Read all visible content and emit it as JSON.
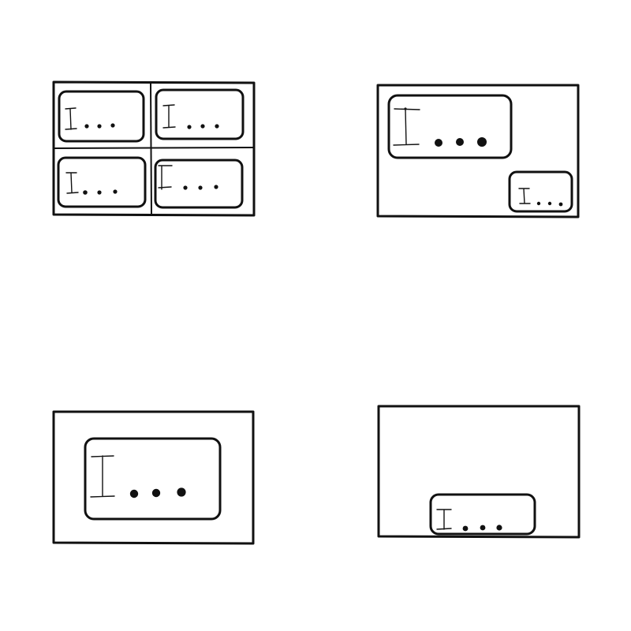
{
  "diagram": {
    "panels": [
      {
        "id": "panel-top-left",
        "layout": "quad-split",
        "text_boxes": [
          {
            "id": "box-q1",
            "icon": "text-cursor-icon",
            "glyph": "..."
          },
          {
            "id": "box-q2",
            "icon": "text-cursor-icon",
            "glyph": "..."
          },
          {
            "id": "box-q3",
            "icon": "text-cursor-icon",
            "glyph": "..."
          },
          {
            "id": "box-q4",
            "icon": "text-cursor-icon",
            "glyph": "..."
          }
        ]
      },
      {
        "id": "panel-top-right",
        "layout": "large-top-left-small-bottom-right",
        "text_boxes": [
          {
            "id": "box-large",
            "icon": "text-cursor-icon",
            "glyph": "..."
          },
          {
            "id": "box-small",
            "icon": "text-cursor-icon",
            "glyph": "..."
          }
        ]
      },
      {
        "id": "panel-bottom-left",
        "layout": "single-centered",
        "text_boxes": [
          {
            "id": "box-center",
            "icon": "text-cursor-icon",
            "glyph": "..."
          }
        ]
      },
      {
        "id": "panel-bottom-right",
        "layout": "single-bottom-centered",
        "text_boxes": [
          {
            "id": "box-bottom",
            "icon": "text-cursor-icon",
            "glyph": "..."
          }
        ]
      }
    ],
    "stroke_color": "#111111",
    "background_color": "#ffffff"
  }
}
